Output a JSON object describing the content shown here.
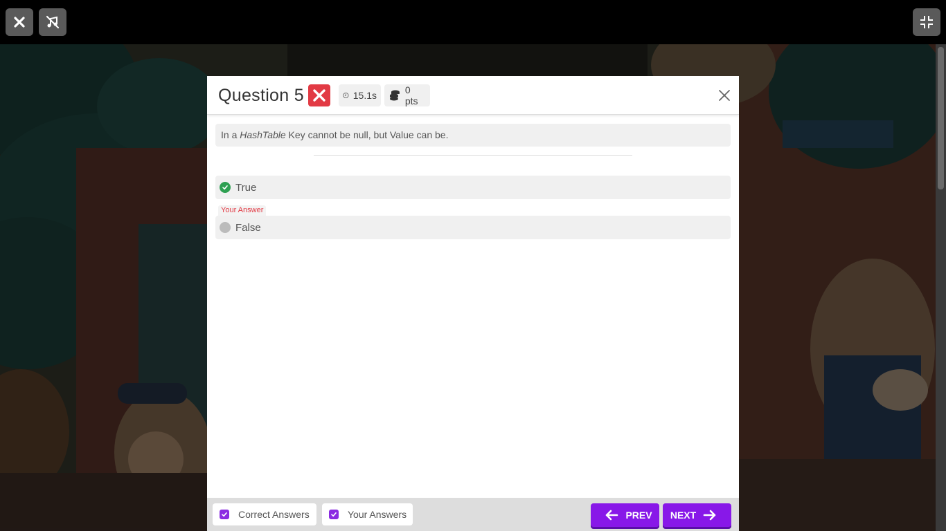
{
  "topbar": {
    "close_icon": "close-icon",
    "music_off_icon": "music-off-icon",
    "shrink_icon": "exit-fullscreen-icon"
  },
  "modal": {
    "title": "Question 5",
    "result_icon": "wrong-icon",
    "time": "15.1s",
    "points": "0 pts",
    "question_prefix": "In a ",
    "question_emphasis": "HashTable",
    "question_suffix": " Key cannot be null, but Value can be.",
    "options": [
      {
        "label": "True",
        "status": "correct"
      },
      {
        "label": "False",
        "status": "your-answer"
      }
    ],
    "your_answer_tag": "Your Answer"
  },
  "footer": {
    "correct_answers_label": "Correct Answers",
    "your_answers_label": "Your Answers",
    "prev_label": "PREV",
    "next_label": "NEXT"
  },
  "colors": {
    "accent": "#8818e8",
    "wrong": "#e23a44",
    "correct": "#2ea052"
  }
}
